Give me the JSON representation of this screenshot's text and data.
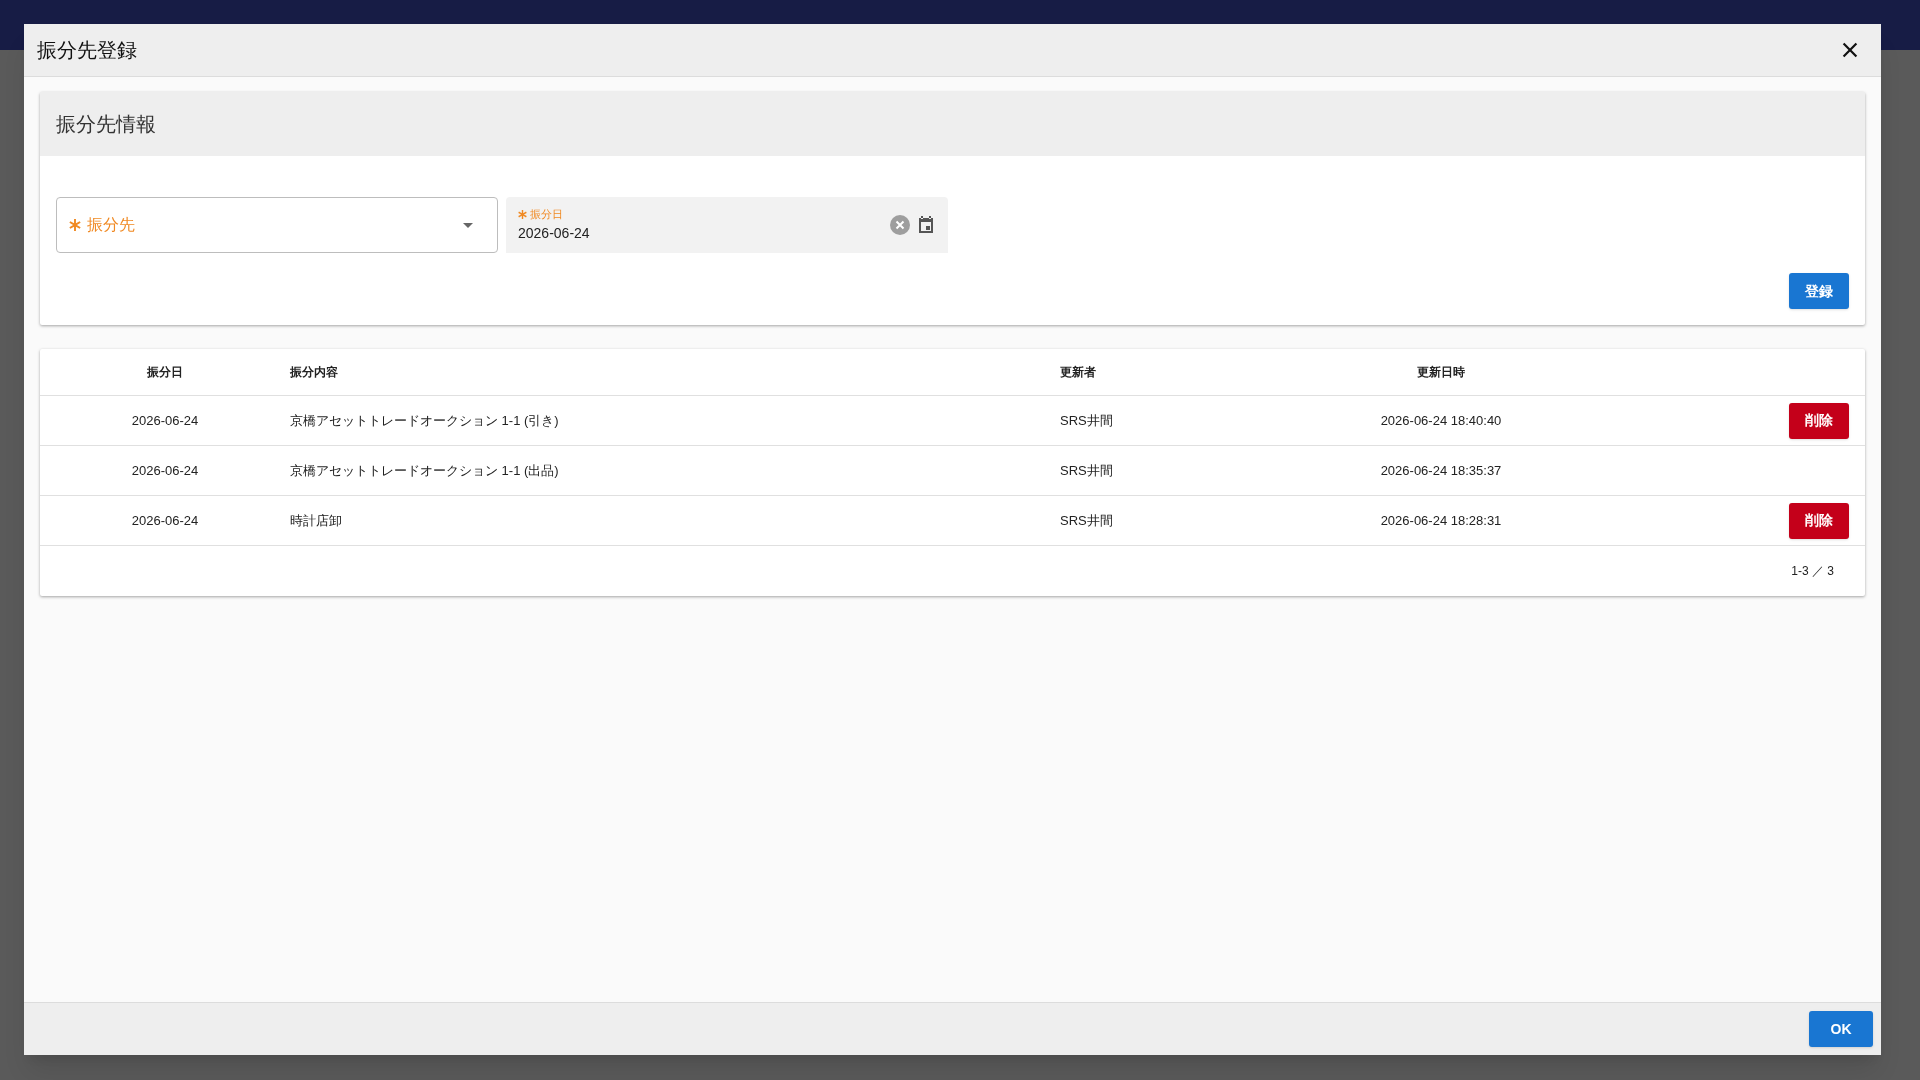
{
  "dialog": {
    "title": "振分先登録"
  },
  "form": {
    "title": "振分先情報",
    "destination": {
      "label": "振分先",
      "required": true
    },
    "date": {
      "label": "振分日",
      "required": true,
      "value": "2026-06-24"
    },
    "submit": "登録"
  },
  "table": {
    "columns": [
      "振分日",
      "振分内容",
      "更新者",
      "更新日時"
    ],
    "rows": [
      {
        "date": "2026-06-24",
        "content": "京橋アセットトレードオークション 1-1 (引き)",
        "user": "SRS井間",
        "updated": "2026-06-24 18:40:40",
        "delete": "削除"
      },
      {
        "date": "2026-06-24",
        "content": "京橋アセットトレードオークション 1-1 (出品)",
        "user": "SRS井間",
        "updated": "2026-06-24 18:35:37"
      },
      {
        "date": "2026-06-24",
        "content": "時計店卸",
        "user": "SRS井間",
        "updated": "2026-06-24 18:28:31",
        "delete": "削除"
      }
    ],
    "pagination": "1-3 ／ 3"
  },
  "footer": {
    "ok": "OK"
  }
}
